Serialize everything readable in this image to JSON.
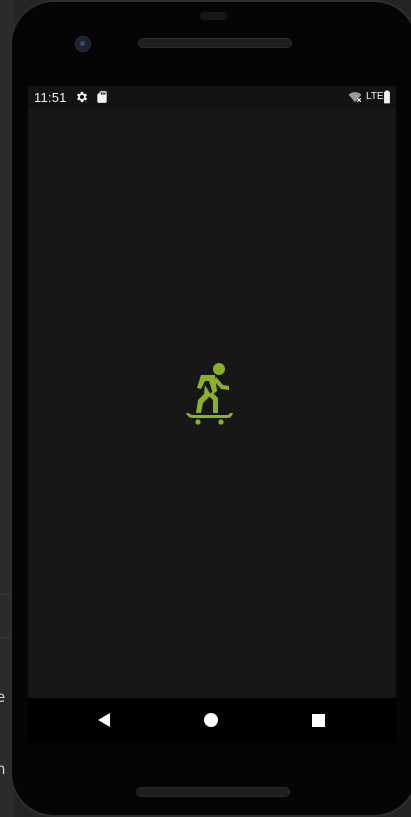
{
  "background": {
    "partial_text_1": "e",
    "partial_text_2": "h"
  },
  "status_bar": {
    "time": "11:51",
    "icons": [
      "gear-icon",
      "sd-card-icon",
      "wifi-off-icon",
      "lte-signal-icon",
      "battery-icon"
    ],
    "network_label": "LTE"
  },
  "app": {
    "icon": "skateboarder-icon",
    "accent_color": "#8db02a",
    "background_color": "#171717"
  },
  "navigation": {
    "buttons": [
      "back-icon",
      "home-icon",
      "recents-icon"
    ]
  }
}
